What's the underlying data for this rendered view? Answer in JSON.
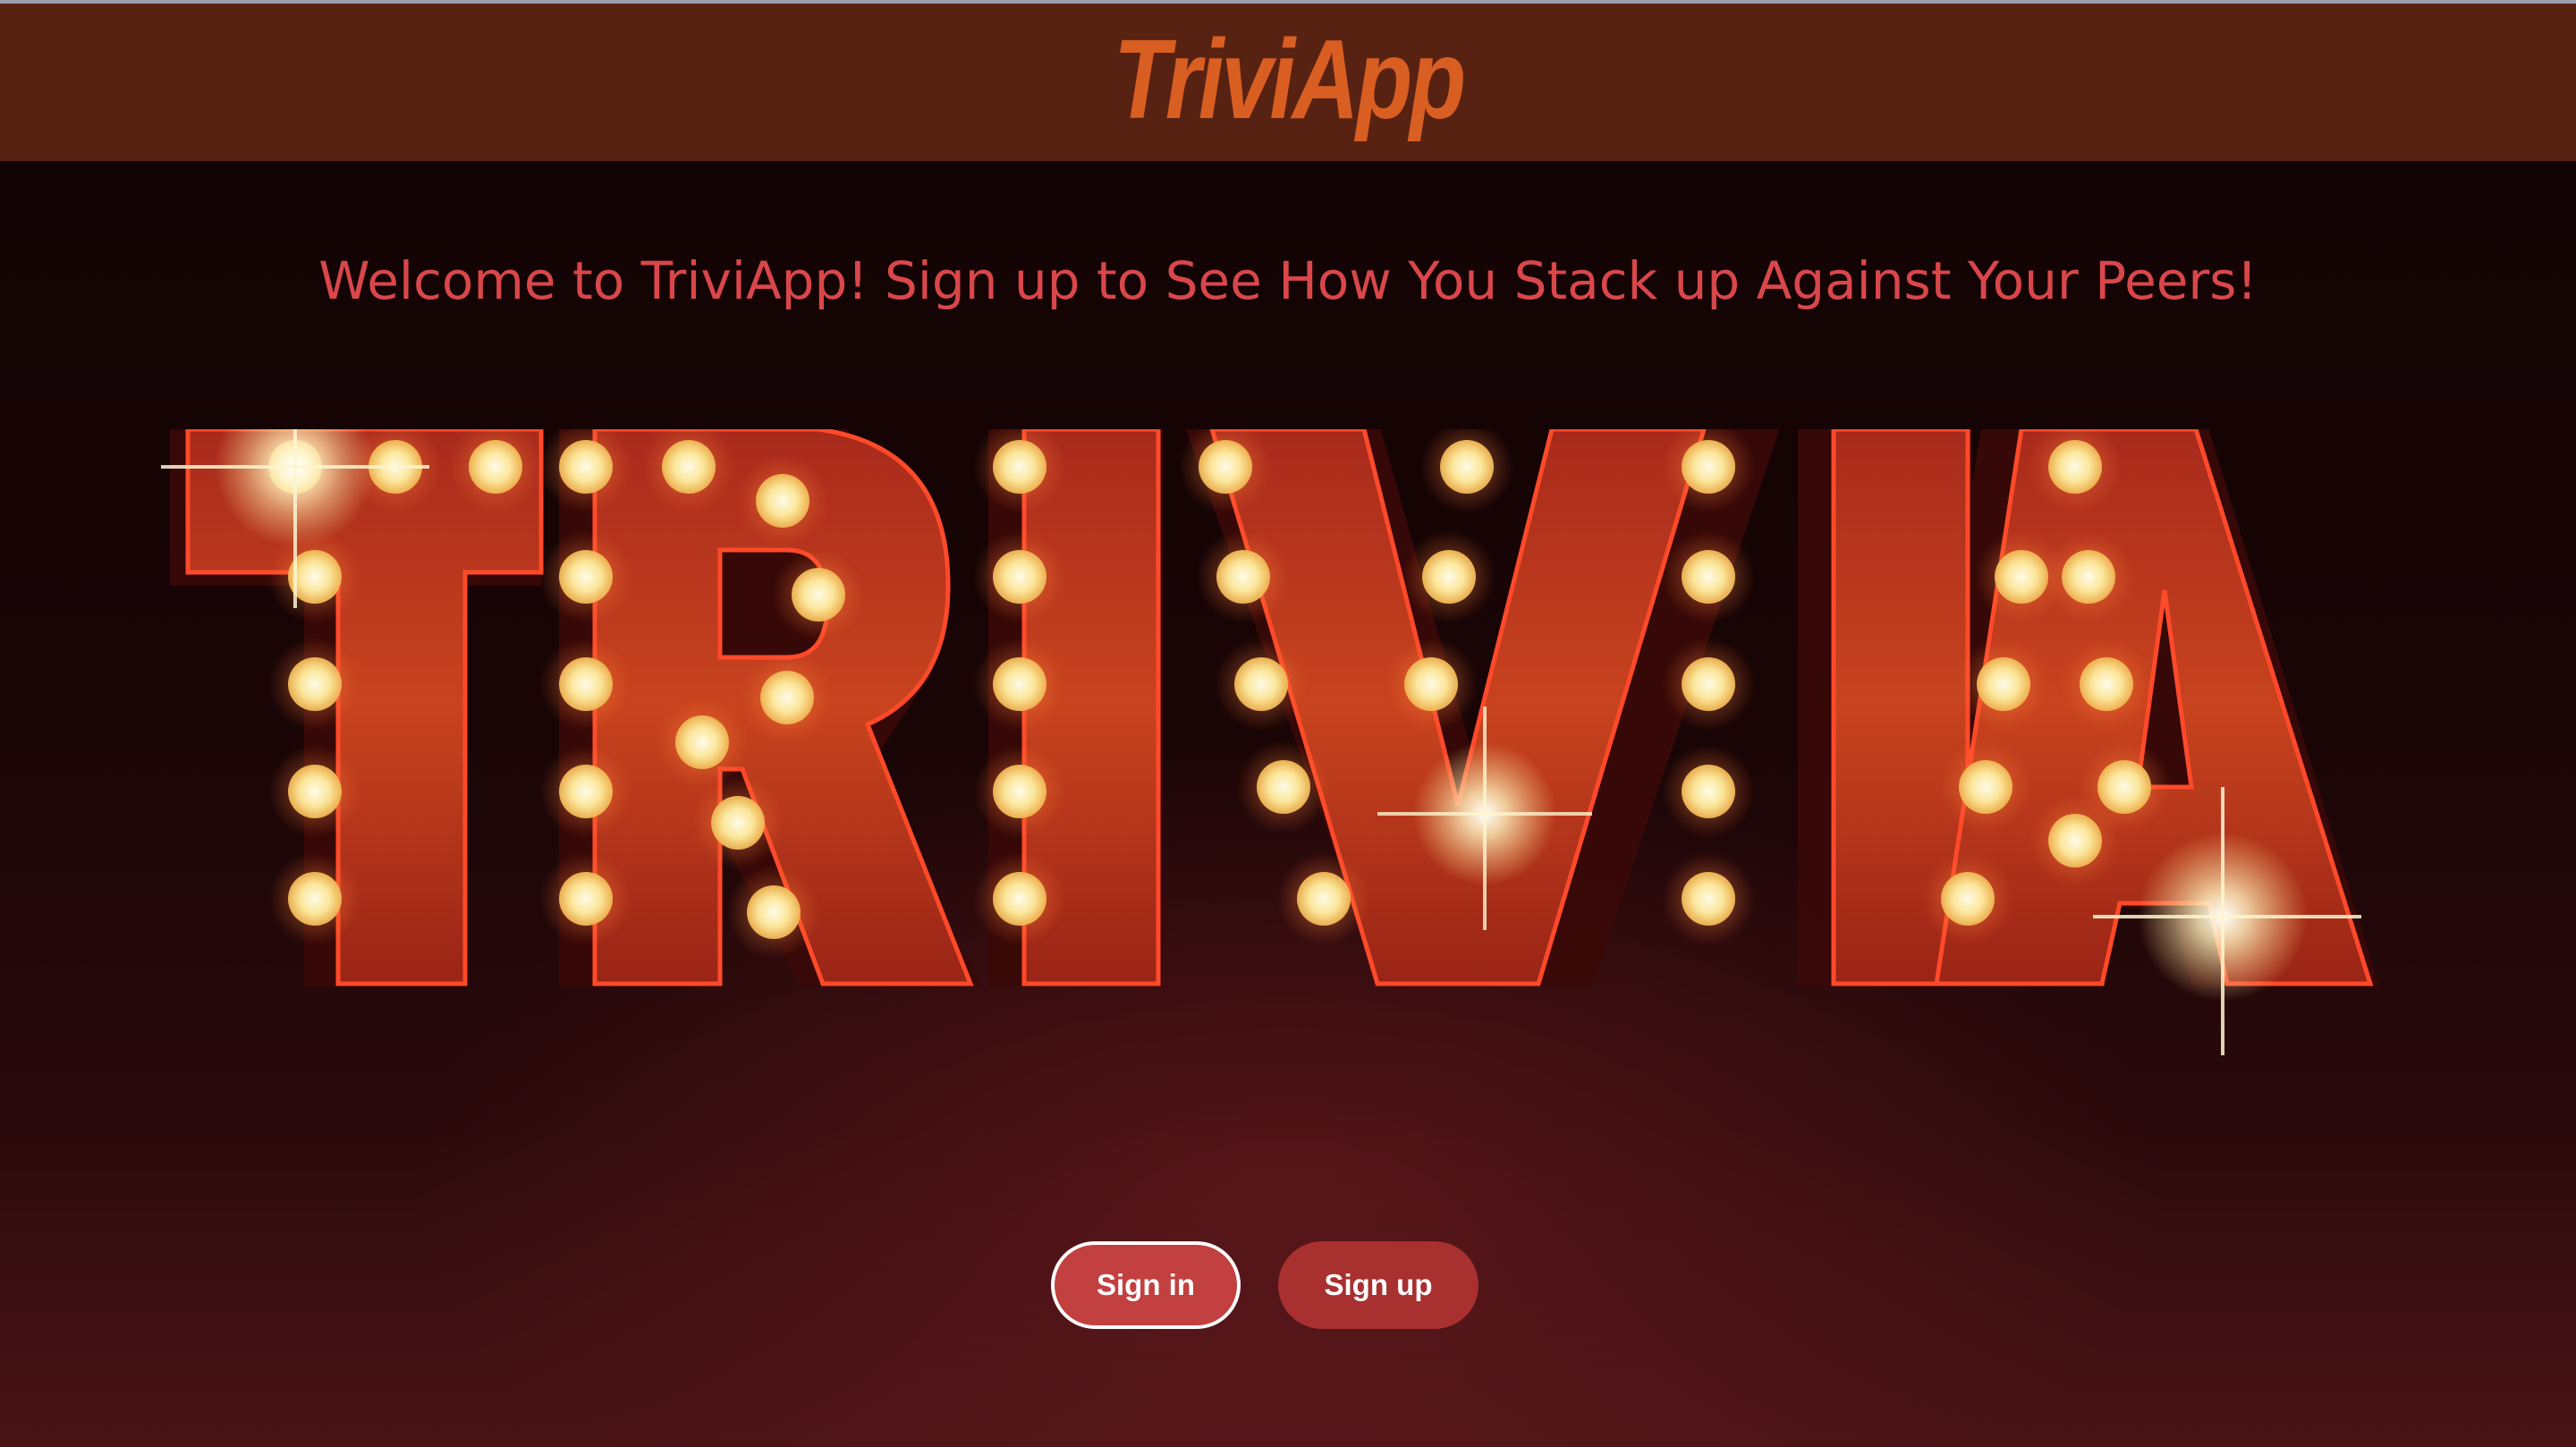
{
  "header": {
    "brand": "TriviApp"
  },
  "hero": {
    "welcome": "Welcome to TriviApp! Sign up to See How You Stack up Against Your Peers!",
    "marquee_word": "TRIVIA"
  },
  "actions": {
    "sign_in": "Sign in",
    "sign_up": "Sign up"
  },
  "colors": {
    "header_bg": "#582213",
    "brand": "#d85e22",
    "welcome_text": "#d9474a",
    "sign_in_bg": "#c2403f",
    "sign_up_bg": "#a8302f"
  }
}
